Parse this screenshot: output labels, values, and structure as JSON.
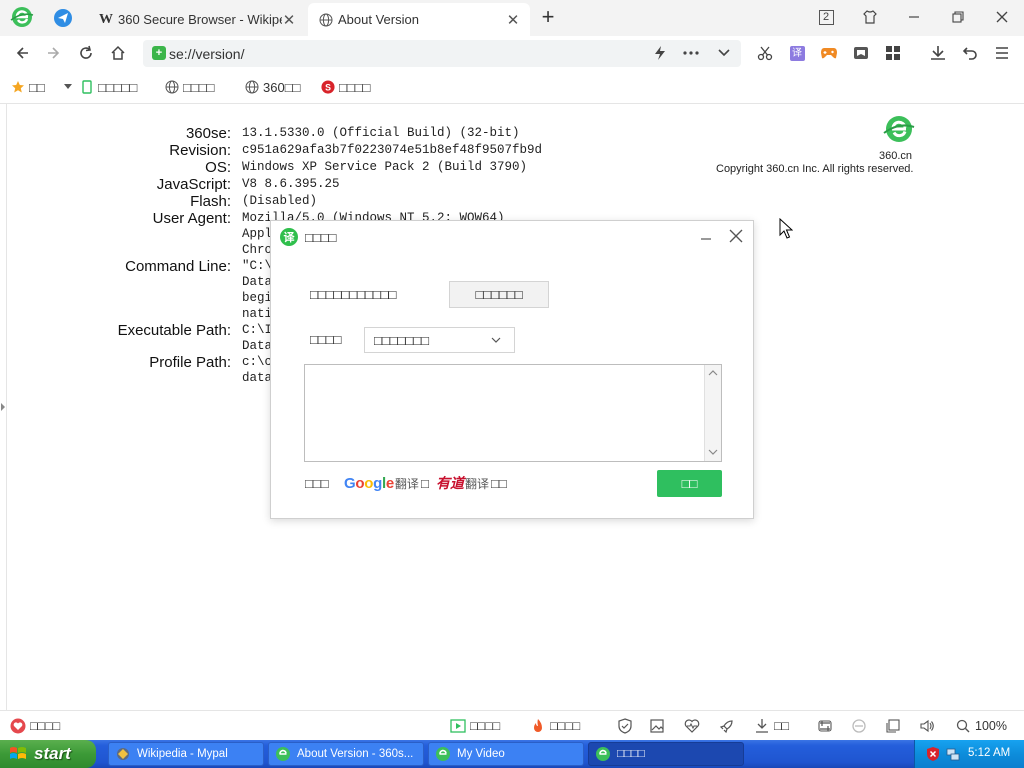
{
  "tabs": [
    {
      "title": "360 Secure Browser - Wikipe",
      "favicon": "W"
    },
    {
      "title": "About Version"
    }
  ],
  "window_controls": {
    "tab_count": "2"
  },
  "address_bar": {
    "url": "se://version/"
  },
  "bookmarks": [
    {
      "label": "□□"
    },
    {
      "label": "□□□□□"
    },
    {
      "label": "□□□□"
    },
    {
      "label": "360□□"
    },
    {
      "label": "□□□□"
    }
  ],
  "version": {
    "rows": [
      {
        "label": "360se:",
        "lines": [
          "13.1.5330.0 (Official Build) (32-bit)"
        ]
      },
      {
        "label": "Revision:",
        "lines": [
          "c951a629afa3b7f0223074e51b8ef48f9507fb9d"
        ]
      },
      {
        "label": "OS:",
        "lines": [
          "Windows XP Service Pack 2 (Build 3790)"
        ]
      },
      {
        "label": "JavaScript:",
        "lines": [
          "V8 8.6.395.25"
        ]
      },
      {
        "label": "Flash:",
        "lines": [
          "(Disabled)"
        ]
      },
      {
        "label": "User Agent:",
        "lines": [
          "Mozilla/5.0 (Windows NT 5.2; WOW64)",
          "Appl",
          "Chro"
        ]
      },
      {
        "label": "Command Line:",
        "lines": [
          "\"C:\\",
          "Data",
          "begi",
          "nati"
        ]
      },
      {
        "label": "Executable Path:",
        "lines": [
          "C:\\I",
          "Data"
        ]
      },
      {
        "label": "Profile Path:",
        "lines": [
          "c:\\c",
          "data"
        ]
      }
    ],
    "logo_caption": "360.cn",
    "copyright": "Copyright 360.cn Inc. All rights reserved."
  },
  "dialog": {
    "icon_char": "译",
    "title": "□□□□",
    "row1_label": "□□□□□□□□□□□",
    "row1_button": "□□□□□□",
    "row2_label": "□□□□",
    "row2_select": "□□□□□□□",
    "provider_prefix": "□□□",
    "google_word": "Google",
    "google_suffix": "翻译",
    "radio_sep": "□",
    "youdao_word": "有道",
    "youdao_suffix": "翻译",
    "provider_suffix": "□□",
    "ok_button": "□□"
  },
  "statusbar": {
    "left_label": "□□□□",
    "items": [
      {
        "label": "□□□□"
      },
      {
        "label": "□□□□"
      },
      {
        "label": "□□"
      }
    ],
    "zoom": "100%"
  },
  "taskbar": {
    "start_label": "start",
    "tasks": [
      {
        "label": "Wikipedia - Mypal"
      },
      {
        "label": "About Version - 360s..."
      },
      {
        "label": "My Video"
      },
      {
        "label": "□□□□"
      }
    ],
    "clock": "5:12 AM"
  },
  "colors": {
    "accent_green": "#2fbf5f",
    "taskbar_blue": "#245edb",
    "start_green": "#3c9a37",
    "tray_blue": "#0d8ddb"
  }
}
